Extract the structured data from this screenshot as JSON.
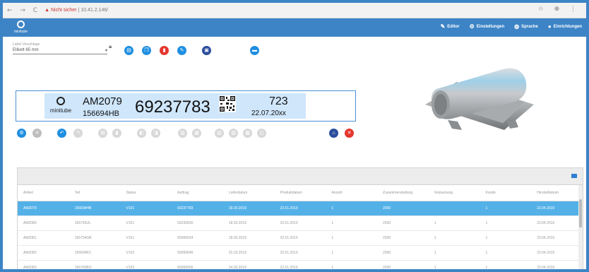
{
  "browser": {
    "nav": "← → C",
    "insecure": "▲ Nicht sicher",
    "host": "| 10.41.2.146/",
    "right_icons": "☆ ⊕ ⋮"
  },
  "app": {
    "logo_text": "minitube",
    "menu": [
      {
        "icon": "pencil-icon",
        "glyph": "✎",
        "label": "Editor"
      },
      {
        "icon": "settings-icon",
        "glyph": "⚙",
        "label": "Einstellungen"
      },
      {
        "icon": "globe-icon",
        "glyph": "◍",
        "label": "Sprache"
      },
      {
        "icon": "user-icon",
        "glyph": "●",
        "label": "Einrichtungen"
      }
    ]
  },
  "label_select": {
    "label": "Label Vorschlage",
    "value": "Etikett 65 mm"
  },
  "toolbar": {
    "top_buttons": [
      {
        "icon": "new-document-icon",
        "glyph": "▤",
        "color": "#1f8fe0"
      },
      {
        "icon": "copy-icon",
        "glyph": "❐",
        "color": "#1f8fe0"
      },
      {
        "icon": "delete-icon",
        "glyph": "▮",
        "color": "#e4372f"
      },
      {
        "icon": "edit-icon",
        "glyph": "✎",
        "color": "#1f8fe0"
      },
      {
        "icon": "save-icon",
        "glyph": "▣",
        "color": "#2a4d9b"
      },
      {
        "icon": "card-icon",
        "glyph": "▬",
        "color": "#1f8fe0"
      }
    ],
    "bottom_buttons": [
      {
        "icon": "settings-icon",
        "glyph": "⚙",
        "color": "#1f8fe0"
      },
      {
        "icon": "close-icon",
        "glyph": "✕",
        "color": "#bdbdbd"
      },
      {
        "icon": "undo-icon",
        "glyph": "↶",
        "color": "#1f8fe0"
      },
      {
        "icon": "redo-icon",
        "glyph": "↷",
        "color": "#d8d8d8"
      },
      {
        "icon": "tool-icon",
        "glyph": "▤",
        "color": "#d8d8d8"
      },
      {
        "icon": "tool-icon",
        "glyph": "▮",
        "color": "#d8d8d8"
      },
      {
        "icon": "tool-icon",
        "glyph": "◧",
        "color": "#d8d8d8"
      },
      {
        "icon": "tool-icon",
        "glyph": "◨",
        "color": "#d8d8d8"
      },
      {
        "icon": "tool-icon",
        "glyph": "▥",
        "color": "#d8d8d8"
      },
      {
        "icon": "tool-icon",
        "glyph": "▦",
        "color": "#d8d8d8"
      },
      {
        "icon": "tool-icon",
        "glyph": "▧",
        "color": "#d8d8d8"
      },
      {
        "icon": "tool-icon",
        "glyph": "▨",
        "color": "#d8d8d8"
      },
      {
        "icon": "tool-icon",
        "glyph": "▩",
        "color": "#d8d8d8"
      },
      {
        "icon": "tool-icon",
        "glyph": "◫",
        "color": "#d8d8d8"
      },
      {
        "icon": "home-icon",
        "glyph": "⌂",
        "color": "#2a4d9b"
      },
      {
        "icon": "cancel-icon",
        "glyph": "✕",
        "color": "#e4372f"
      }
    ]
  },
  "label_preview": {
    "brand": "minitube",
    "article": "AM2079",
    "batch": "156694HB",
    "number": "69237783",
    "count": "723",
    "date": "22.07.20xx"
  },
  "table": {
    "columns": [
      "Artikel",
      "Teil",
      "Status",
      "Auftrag",
      "Lieferdatum",
      "Produktdatum",
      "Anzahl",
      "Zusammenstellung",
      "Verpackung",
      "Kunde",
      "Herstelldatum"
    ],
    "rows": [
      [
        "AM2079",
        "156694HB",
        "V101",
        "69237783",
        "18.03.2019",
        "22.01.2019",
        "1",
        "2000",
        "",
        "1",
        "22.04.2019"
      ],
      [
        "AM2080",
        "156743UL",
        "V101",
        "69239930",
        "18.03.2019",
        "22.01.2019",
        "1",
        "2000",
        "1",
        "1",
        "23.04.2019"
      ],
      [
        "AM2081",
        "156754GB",
        "V101",
        "69999934",
        "18.03.2019",
        "22.01.2019",
        "1",
        "2000",
        "1",
        "1",
        "23.04.2019"
      ],
      [
        "AM2082",
        "156694KC",
        "V102",
        "69999946",
        "22.03.2019",
        "22.01.2019",
        "1",
        "2000",
        "1",
        "1",
        "23.04.2019"
      ],
      [
        "AM2083",
        "156760BO",
        "V103",
        "69999956",
        "24.03.2019",
        "22.01.2019",
        "1",
        "2000",
        "1",
        "1",
        "23.04.2019"
      ]
    ]
  }
}
